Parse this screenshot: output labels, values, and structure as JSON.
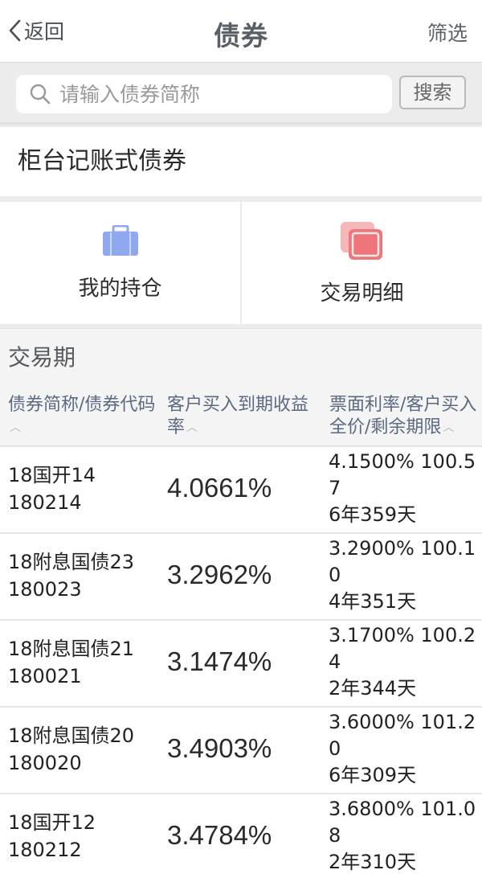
{
  "header": {
    "back_label": "返回",
    "title": "债券",
    "filter_label": "筛选"
  },
  "search": {
    "placeholder": "请输入债券简称",
    "button_label": "搜索"
  },
  "section": {
    "title": "柜台记账式债券"
  },
  "tiles": [
    {
      "label": "我的持仓",
      "icon": "briefcase-icon",
      "color": "#8fa8f0"
    },
    {
      "label": "交易明细",
      "icon": "stacked-cards-icon",
      "color": "#f0757a"
    }
  ],
  "period_label": "交易期",
  "table": {
    "columns": [
      "债券简称/债券代码",
      "客户买入到期收益率",
      "票面利率/客户买入全价/剩余期限"
    ],
    "rows": [
      {
        "name": "18国开14",
        "code": "180214",
        "yield": "4.0661%",
        "rate_price": "4.1500% 100.57",
        "term": "6年359天"
      },
      {
        "name": "18附息国债23",
        "code": "180023",
        "yield": "3.2962%",
        "rate_price": "3.2900% 100.10",
        "term": "4年351天"
      },
      {
        "name": "18附息国债21",
        "code": "180021",
        "yield": "3.1474%",
        "rate_price": "3.1700% 100.24",
        "term": "2年344天"
      },
      {
        "name": "18附息国债20",
        "code": "180020",
        "yield": "3.4903%",
        "rate_price": "3.6000% 101.20",
        "term": "6年309天"
      },
      {
        "name": "18国开12",
        "code": "180212",
        "yield": "3.4784%",
        "rate_price": "3.6800% 101.08",
        "term": "2年310天"
      }
    ]
  }
}
